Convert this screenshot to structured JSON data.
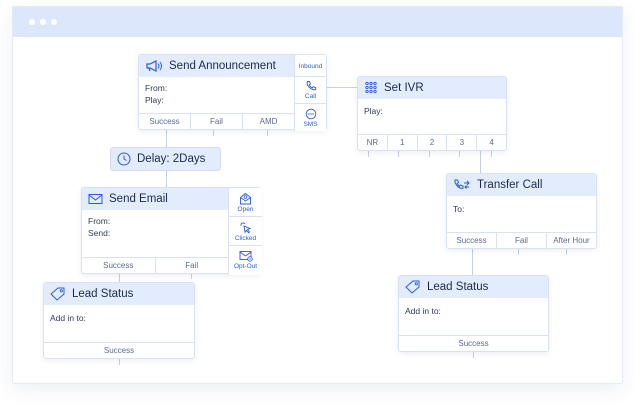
{
  "colors": {
    "accent": "#2a5bd7",
    "header_bg": "#e3ecfc",
    "titlebar": "#dde7fb"
  },
  "announcement": {
    "title": "Send Announcement",
    "fields": [
      "From:",
      "Play:"
    ],
    "outputs": [
      "Success",
      "Fail",
      "AMD"
    ],
    "side": [
      {
        "label": "Inbound",
        "icon": "inbound-label"
      },
      {
        "label": "Call",
        "icon": "phone-icon"
      },
      {
        "label": "SMS",
        "icon": "sms-icon"
      }
    ]
  },
  "ivr": {
    "title": "Set IVR",
    "fields": [
      "Play:"
    ],
    "outputs": [
      "NR",
      "1",
      "2",
      "3",
      "4"
    ]
  },
  "delay": {
    "title": "Delay: 2Days"
  },
  "email": {
    "title": "Send Email",
    "fields": [
      "From:",
      "Send:"
    ],
    "outputs": [
      "Success",
      "Fail"
    ],
    "side": [
      {
        "label": "Open",
        "icon": "open-mail-icon"
      },
      {
        "label": "Clicked",
        "icon": "cursor-click-icon"
      },
      {
        "label": "Opt-Out",
        "icon": "opt-out-icon"
      }
    ]
  },
  "transfer": {
    "title": "Transfer Call",
    "fields": [
      "To:"
    ],
    "outputs": [
      "Success",
      "Fail",
      "After Hour"
    ]
  },
  "lead_left": {
    "title": "Lead Status",
    "fields": [
      "Add in to:"
    ],
    "outputs": [
      "Success"
    ]
  },
  "lead_right": {
    "title": "Lead Status",
    "fields": [
      "Add in to:"
    ],
    "outputs": [
      "Success"
    ]
  }
}
